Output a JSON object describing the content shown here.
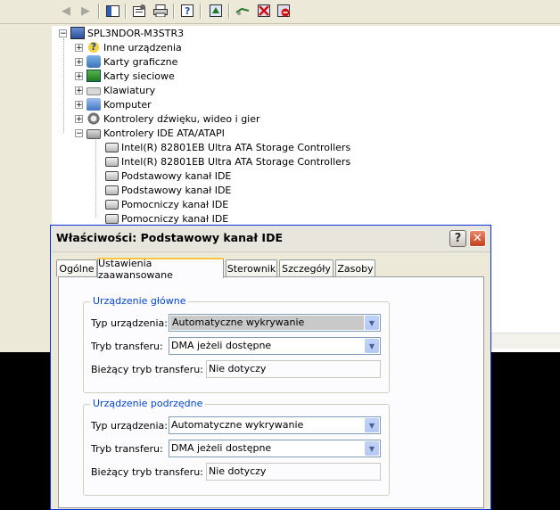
{
  "device_manager": {
    "toolbar": [
      "back-icon",
      "forward-icon",
      "console-tree-icon",
      "properties-icon",
      "print-icon",
      "help-icon",
      "update-driver-icon",
      "scan-icon",
      "uninstall-icon",
      "disable-icon"
    ],
    "tree": {
      "root": "SPL3NDOR-M3STR3",
      "categories": [
        {
          "label": "Inne urządzenia",
          "icon": "question-icon",
          "expander": "+"
        },
        {
          "label": "Karty graficzne",
          "icon": "display-icon",
          "expander": "+"
        },
        {
          "label": "Karty sieciowe",
          "icon": "network-icon",
          "expander": "+"
        },
        {
          "label": "Klawiatury",
          "icon": "keyboard-icon",
          "expander": "+"
        },
        {
          "label": "Komputer",
          "icon": "computer-icon",
          "expander": "+"
        },
        {
          "label": "Kontrolery dźwięku, wideo i gier",
          "icon": "sound-icon",
          "expander": "+"
        },
        {
          "label": "Kontrolery IDE ATA/ATAPI",
          "icon": "ide-icon",
          "expander": "−"
        }
      ],
      "ide_children": [
        "Intel(R) 82801EB Ultra ATA Storage Controllers",
        "Intel(R) 82801EB Ultra ATA Storage Controllers",
        "Podstawowy kanał IDE",
        "Podstawowy kanał IDE",
        "Pomocniczy kanał IDE",
        "Pomocniczy kanał IDE"
      ]
    }
  },
  "dialog": {
    "title": "Właściwości: Podstawowy kanał IDE",
    "help_label": "?",
    "close_label": "✕",
    "tabs": [
      "Ogólne",
      "Ustawienia zaawansowane",
      "Sterownik",
      "Szczegóły",
      "Zasoby"
    ],
    "active_tab": "Ustawienia zaawansowane",
    "primary": {
      "legend": "Urządzenie główne",
      "device_type_label": "Typ urządzenia:",
      "device_type_value": "Automatyczne wykrywanie",
      "transfer_mode_label": "Tryb transferu:",
      "transfer_mode_value": "DMA jeżeli dostępne",
      "current_mode_label": "Bieżący tryb transferu:",
      "current_mode_value": "Nie dotyczy"
    },
    "secondary": {
      "legend": "Urządzenie podrzędne",
      "device_type_label": "Typ urządzenia:",
      "device_type_value": "Automatyczne wykrywanie",
      "transfer_mode_label": "Tryb transferu:",
      "transfer_mode_value": "DMA jeżeli dostępne",
      "current_mode_label": "Bieżący tryb transferu:",
      "current_mode_value": "Nie dotyczy"
    }
  }
}
